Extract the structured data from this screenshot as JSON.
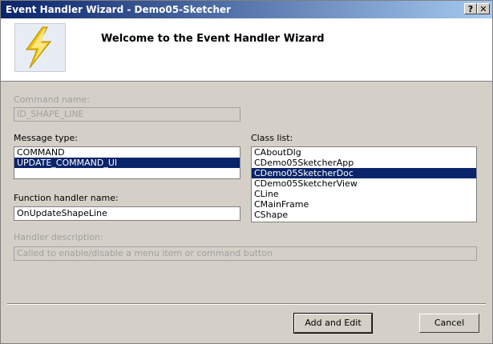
{
  "window": {
    "title": "Event Handler Wizard - Demo05-Sketcher",
    "help_label": "?",
    "close_label": "✕"
  },
  "header": {
    "welcome": "Welcome to the Event Handler Wizard",
    "logo_icon": "lightning-bolt-icon"
  },
  "command": {
    "label": "Command name:",
    "value": "ID_SHAPE_LINE"
  },
  "message_type": {
    "label": "Message type:",
    "items": [
      "COMMAND",
      "UPDATE_COMMAND_UI"
    ],
    "selected": "UPDATE_COMMAND_UI"
  },
  "class_list": {
    "label": "Class list:",
    "items": [
      "CAboutDlg",
      "CDemo05SketcherApp",
      "CDemo05SketcherDoc",
      "CDemo05SketcherView",
      "CLine",
      "CMainFrame",
      "CShape"
    ],
    "selected": "CDemo05SketcherDoc"
  },
  "function_handler": {
    "label": "Function handler name:",
    "value": "OnUpdateShapeLine"
  },
  "handler_description": {
    "label": "Handler description:",
    "value": "Called to enable/disable a menu item or command button"
  },
  "buttons": {
    "add_edit": "Add and Edit",
    "cancel": "Cancel"
  }
}
